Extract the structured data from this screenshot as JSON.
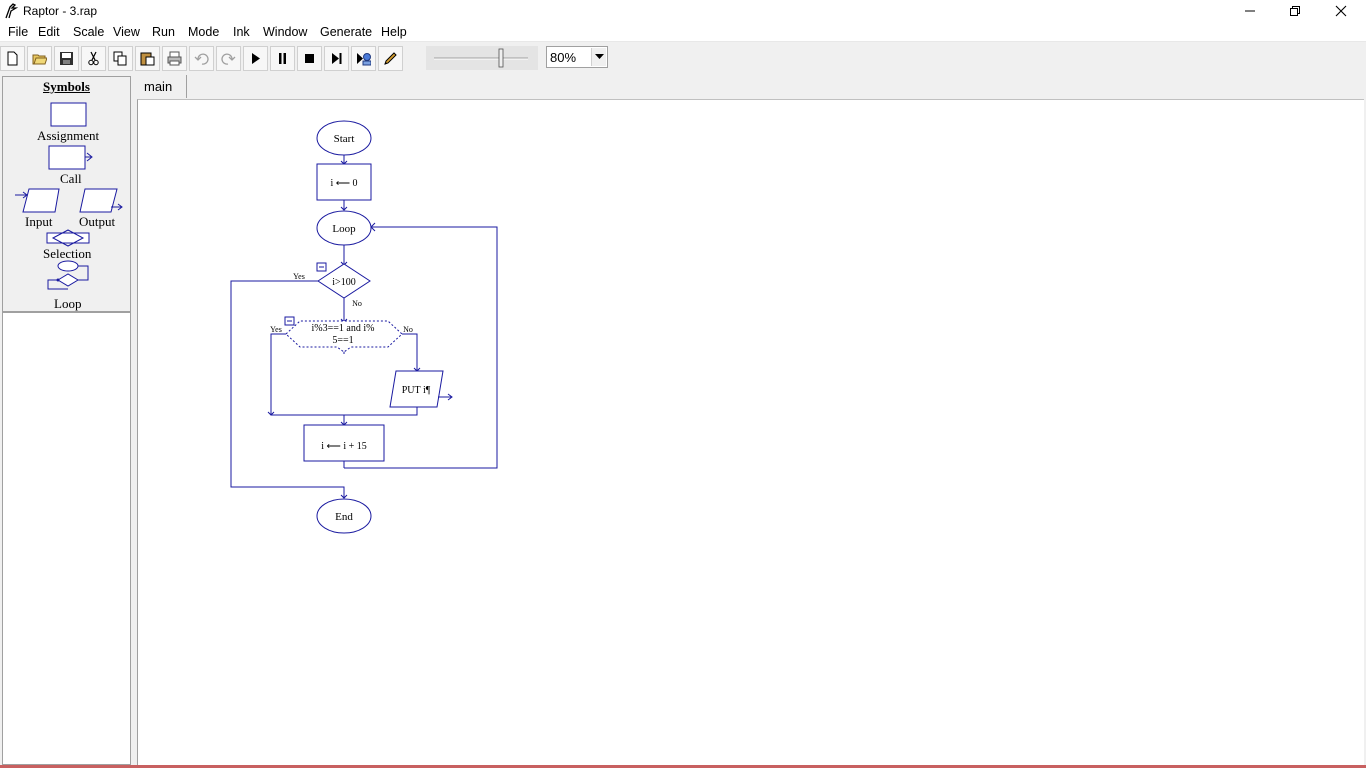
{
  "window": {
    "title": "Raptor - 3.rap"
  },
  "menu": [
    "File",
    "Edit",
    "Scale",
    "View",
    "Run",
    "Mode",
    "Ink",
    "Window",
    "Generate",
    "Help"
  ],
  "toolbar": {
    "zoom_value": "80%"
  },
  "symbols": {
    "title": "Symbols",
    "assignment": "Assignment",
    "call": "Call",
    "input": "Input",
    "output": "Output",
    "selection": "Selection",
    "loop": "Loop"
  },
  "tabs": {
    "main": "main"
  },
  "flowchart": {
    "start": "Start",
    "assign1": "i ⟵ 0",
    "loop": "Loop",
    "cond1": "i>100",
    "yes": "Yes",
    "no": "No",
    "cond2_line1": "i%3==1 and i%",
    "cond2_line2": "5==1",
    "output": "PUT i¶",
    "assign2": "i ⟵ i + 15",
    "end": "End"
  }
}
